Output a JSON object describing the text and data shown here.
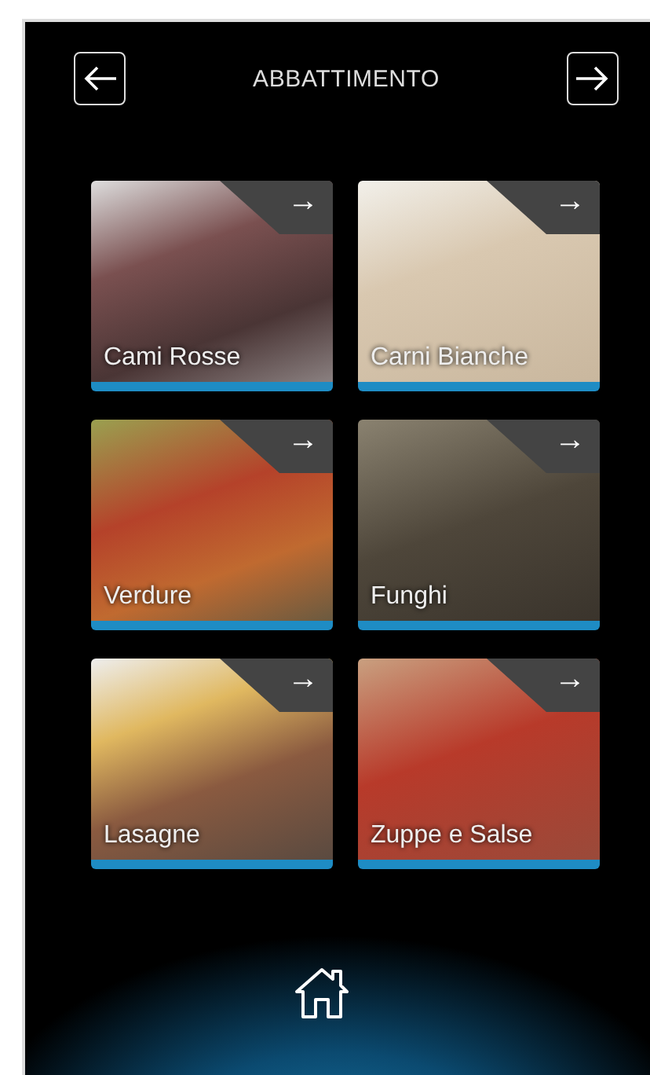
{
  "header": {
    "title": "ABBATTIMENTO"
  },
  "tiles": [
    {
      "label": "Cami Rosse",
      "arrow": "→"
    },
    {
      "label": "Carni Bianche",
      "arrow": "→"
    },
    {
      "label": "Verdure",
      "arrow": "→"
    },
    {
      "label": "Funghi",
      "arrow": "→"
    },
    {
      "label": "Lasagne",
      "arrow": "→"
    },
    {
      "label": "Zuppe e Salse",
      "arrow": "→"
    }
  ]
}
